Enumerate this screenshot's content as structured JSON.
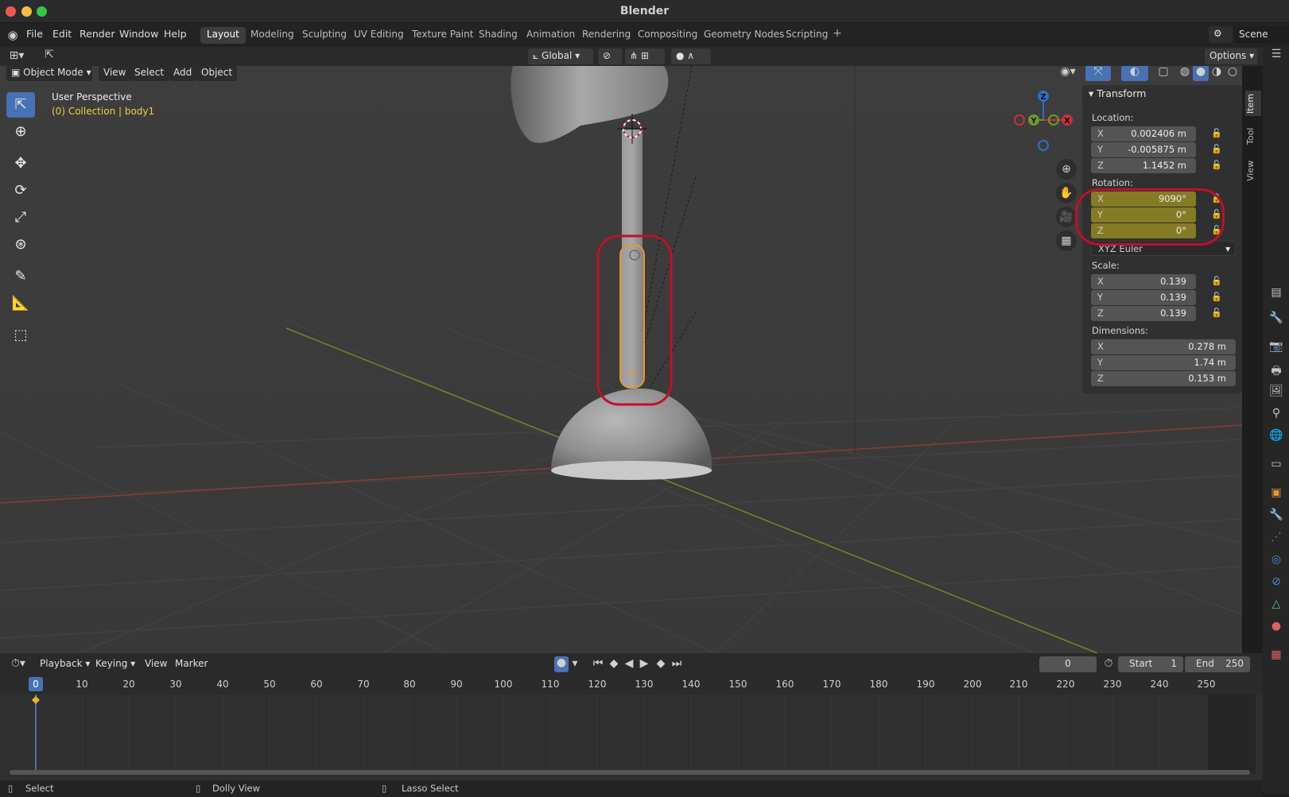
{
  "window": {
    "title": "Blender"
  },
  "menus": [
    "File",
    "Edit",
    "Render",
    "Window",
    "Help"
  ],
  "workspaces": [
    "Layout",
    "Modeling",
    "Sculpting",
    "UV Editing",
    "Texture Paint",
    "Shading",
    "Animation",
    "Rendering",
    "Compositing",
    "Geometry Nodes",
    "Scripting"
  ],
  "active_workspace": "Layout",
  "scene": {
    "label": "Scene"
  },
  "header": {
    "orientation": "Global",
    "options": "Options"
  },
  "viewport_header": {
    "mode": "Object Mode",
    "menus": [
      "View",
      "Select",
      "Add",
      "Object"
    ]
  },
  "viewport": {
    "perspective": "User Perspective",
    "collection": "(0) Collection | body1"
  },
  "gizmo": {
    "z": "Z",
    "y": "Y",
    "x": "X"
  },
  "sidebar_tabs": [
    "Item",
    "Tool",
    "View"
  ],
  "transform": {
    "title": "Transform",
    "location_label": "Location:",
    "location": [
      {
        "axis": "X",
        "value": "0.002406 m"
      },
      {
        "axis": "Y",
        "value": "-0.005875 m"
      },
      {
        "axis": "Z",
        "value": "1.1452 m"
      }
    ],
    "rotation_label": "Rotation:",
    "rotation": [
      {
        "axis": "X",
        "value": "9090°"
      },
      {
        "axis": "Y",
        "value": "0°"
      },
      {
        "axis": "Z",
        "value": "0°"
      }
    ],
    "rotation_mode": "XYZ Euler",
    "scale_label": "Scale:",
    "scale": [
      {
        "axis": "X",
        "value": "0.139"
      },
      {
        "axis": "Y",
        "value": "0.139"
      },
      {
        "axis": "Z",
        "value": "0.139"
      }
    ],
    "dimensions_label": "Dimensions:",
    "dimensions": [
      {
        "axis": "X",
        "value": "0.278 m"
      },
      {
        "axis": "Y",
        "value": "1.74 m"
      },
      {
        "axis": "Z",
        "value": "0.153 m"
      }
    ]
  },
  "timeline": {
    "menus": [
      "Playback",
      "Keying",
      "View",
      "Marker"
    ],
    "current_frame": "0",
    "start_label": "Start",
    "start": "1",
    "end_label": "End",
    "end": "250",
    "ticks": [
      "0",
      "10",
      "20",
      "30",
      "40",
      "50",
      "60",
      "70",
      "80",
      "90",
      "100",
      "110",
      "120",
      "130",
      "140",
      "150",
      "160",
      "170",
      "180",
      "190",
      "200",
      "210",
      "220",
      "230",
      "240",
      "250"
    ]
  },
  "status": {
    "select": "Select",
    "dolly": "Dolly View",
    "lasso": "Lasso Select"
  },
  "colors": {
    "accent": "#4772b3",
    "highlight": "#c0102a",
    "rotation_field": "#857b25",
    "selection": "#e8962e"
  }
}
